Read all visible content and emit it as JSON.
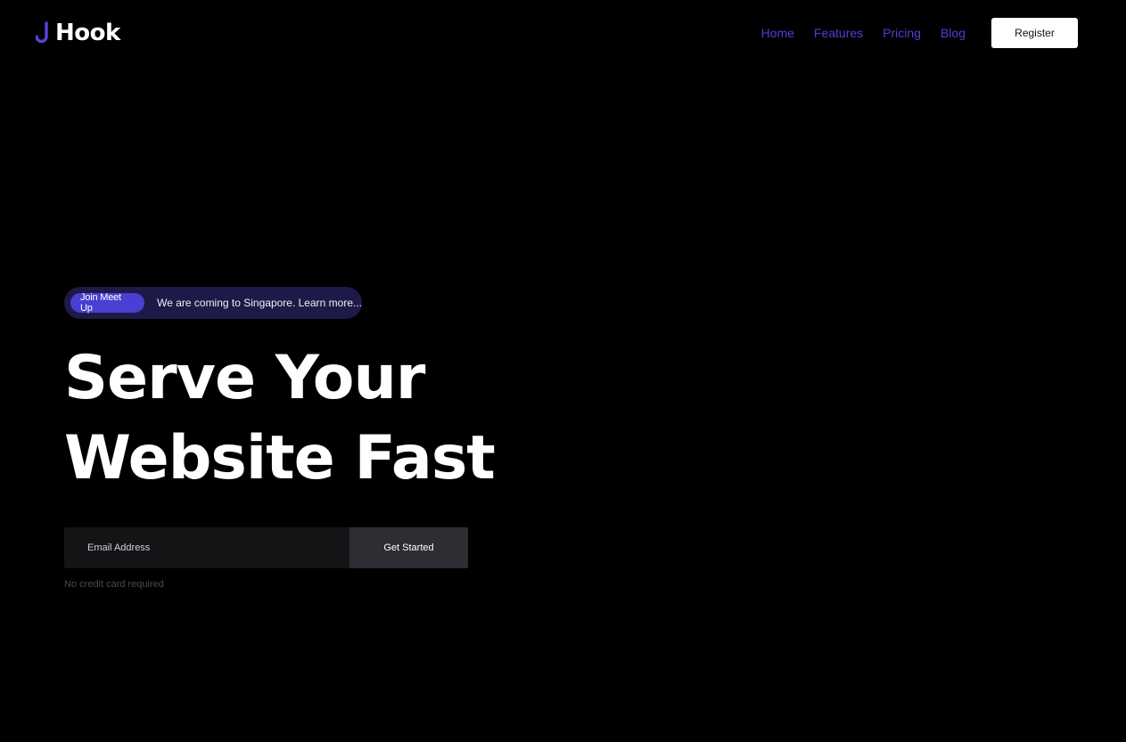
{
  "brand": {
    "name": "Hook",
    "logo_icon": "hook-icon",
    "accent_color": "#4b3fd1"
  },
  "nav": {
    "items": [
      {
        "label": "Home"
      },
      {
        "label": "Features"
      },
      {
        "label": "Pricing"
      },
      {
        "label": "Blog"
      }
    ],
    "link_color": "#4f3fd6",
    "register_label": "Register"
  },
  "announcement": {
    "badge": "Join Meet Up",
    "text": "We are coming to Singapore. Learn more..."
  },
  "hero": {
    "line1": "Serve Your",
    "line2": "Website Fast"
  },
  "signup": {
    "email_placeholder": "Email Address",
    "email_value": "",
    "button_label": "Get Started",
    "note": "No credit card required"
  }
}
